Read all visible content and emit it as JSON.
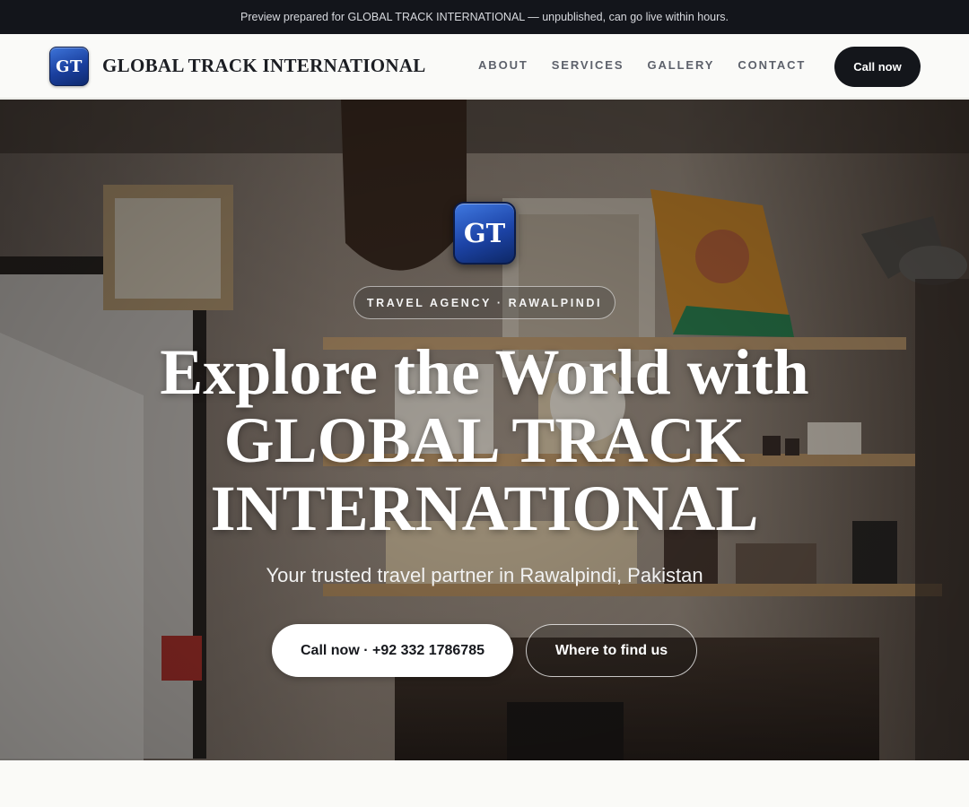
{
  "banner": {
    "text": "Preview prepared for GLOBAL TRACK INTERNATIONAL — unpublished, can go live within hours."
  },
  "header": {
    "logo_text": "GT",
    "brand_name": "GLOBAL TRACK INTERNATIONAL",
    "nav": [
      {
        "label": "ABOUT"
      },
      {
        "label": "SERVICES"
      },
      {
        "label": "GALLERY"
      },
      {
        "label": "CONTACT"
      }
    ],
    "call_button": "Call now"
  },
  "hero": {
    "logo_text": "GT",
    "tag": "TRAVEL AGENCY · RAWALPINDI",
    "headline_lines": [
      "Explore the World with",
      "GLOBAL TRACK",
      "INTERNATIONAL"
    ],
    "subtitle": "Your trusted travel partner in Rawalpindi, Pakistan",
    "primary_button": "Call now · +92 332 1786785",
    "secondary_button": "Where to find us",
    "background_image": "travel-agency-office-interior-photo"
  },
  "colors": {
    "banner_bg": "#13151b",
    "header_bg": "#fafaf8",
    "logo_blue": "#1a3f9e",
    "dark_button": "#14161b",
    "page_bg": "#fafaf7"
  }
}
